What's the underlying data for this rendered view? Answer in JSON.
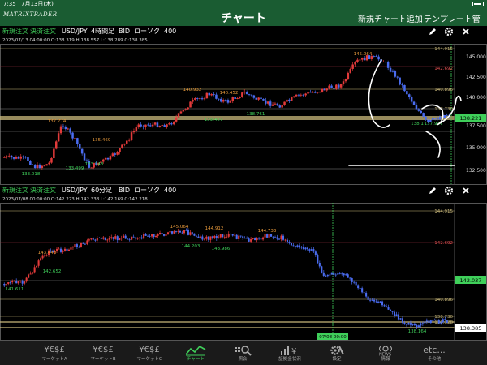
{
  "status": {
    "time": "7:35",
    "date": "7月13日(木)"
  },
  "header": {
    "logo": "MATRIXTRADER",
    "title": "チャート",
    "actions": [
      "新規チャート追加",
      "テンプレート管理"
    ]
  },
  "panels": [
    {
      "toolbar": {
        "new_order": "新規注文",
        "close_order": "決済注文",
        "pair": "USD/JPY",
        "timeframe": "4時間足",
        "side": "BID",
        "style": "ローソク",
        "count": "400"
      },
      "info": "2023/07/13 04:00:00   O:138.319   H:138.557   L:138.289   C:138.385",
      "y_axis": {
        "ticks": [
          "145.000",
          "142.500",
          "140.000",
          "137.500",
          "135.000",
          "132.500"
        ],
        "current_price": "138.221"
      },
      "level_labels": [
        "144.915",
        "142.692",
        "140.896",
        "138.730"
      ],
      "annotations": [
        {
          "text": "145.064",
          "color": "#e89a3c"
        },
        {
          "text": "140.932",
          "color": "#e89a3c"
        },
        {
          "text": "140.452",
          "color": "#e89a3c"
        },
        {
          "text": "137.774",
          "color": "#e89a3c"
        },
        {
          "text": "135.469",
          "color": "#e89a3c"
        },
        {
          "text": "139.407",
          "color": "#3fcf5a"
        },
        {
          "text": "138.761",
          "color": "#3fcf5a"
        },
        {
          "text": "133.499",
          "color": "#3fcf5a"
        },
        {
          "text": "133.743",
          "color": "#3fcf5a"
        },
        {
          "text": "133.018",
          "color": "#3fcf5a"
        },
        {
          "text": "137.937",
          "color": "#3fcf5a"
        },
        {
          "text": "138.1",
          "color": "#3fcf5a"
        }
      ]
    },
    {
      "toolbar": {
        "new_order": "新規注文",
        "close_order": "決済注文",
        "pair": "USD/JPY",
        "timeframe": "60分足",
        "side": "BID",
        "style": "ローソク",
        "count": "400"
      },
      "info": "2023/07/08 00:00:00   O:142.223   H:142.338   L:142.169   C:142.218",
      "y_axis": {
        "current_price": "142.037"
      },
      "level_labels": [
        "144.915",
        "142.692",
        "140.896",
        "138.730",
        "138.328",
        "138.385"
      ],
      "annotations": [
        {
          "text": "145.064",
          "color": "#e89a3c"
        },
        {
          "text": "144.912",
          "color": "#e89a3c"
        },
        {
          "text": "144.733",
          "color": "#e89a3c"
        },
        {
          "text": "143.443",
          "color": "#e89a3c"
        },
        {
          "text": "144.203",
          "color": "#3fcf5a"
        },
        {
          "text": "143.986",
          "color": "#3fcf5a"
        },
        {
          "text": "142.652",
          "color": "#3fcf5a"
        },
        {
          "text": "141.611",
          "color": "#3fcf5a"
        },
        {
          "text": "138.164",
          "color": "#3fcf5a"
        }
      ],
      "x_label": "07/08 00:00"
    }
  ],
  "tabs": [
    {
      "icon": "¥€$£",
      "label": "マーケットA",
      "active": false
    },
    {
      "icon": "¥€$£",
      "label": "マーケットB",
      "active": false
    },
    {
      "icon": "¥€$£",
      "label": "マーケットC",
      "active": false
    },
    {
      "icon": "chart-icon",
      "label": "チャート",
      "active": true
    },
    {
      "icon": "search-icon",
      "label": "照会",
      "active": false
    },
    {
      "icon": "bar-yen-icon",
      "label": "証拠金状況",
      "active": false
    },
    {
      "icon": "gear-wrench-icon",
      "label": "設定",
      "active": false
    },
    {
      "icon": "NEWS",
      "label": "情報",
      "active": false
    },
    {
      "icon": "etc...",
      "label": "その他",
      "active": false
    }
  ],
  "colors": {
    "header": "#1a5c32",
    "accent": "#3fcf5a",
    "up": "#e23a3a",
    "down": "#4a6cf0",
    "level": "#c9b87a"
  }
}
